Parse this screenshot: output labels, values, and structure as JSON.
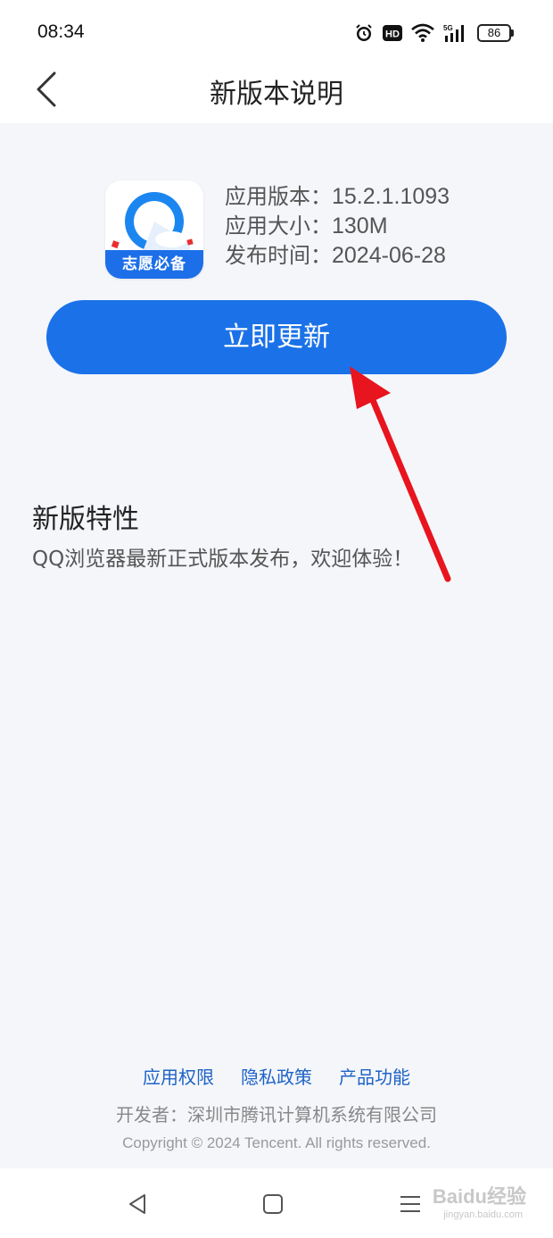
{
  "status_bar": {
    "time": "08:34",
    "icons": [
      "alarm-icon",
      "hd-icon",
      "wifi-icon",
      "5g-signal-icon"
    ],
    "hd_label": "HD",
    "network_label": "5G",
    "battery": "86"
  },
  "header": {
    "title": "新版本说明"
  },
  "app": {
    "icon_banner": "志愿必备",
    "version_label": "应用版本：",
    "version": "15.2.1.1093",
    "size_label": "应用大小：",
    "size": "130M",
    "date_label": "发布时间：",
    "date": "2024-06-28"
  },
  "update_button": {
    "label": "立即更新"
  },
  "features": {
    "heading": "新版特性",
    "text": "QQ浏览器最新正式版本发布，欢迎体验！"
  },
  "footer": {
    "links": [
      "应用权限",
      "隐私政策",
      "产品功能"
    ],
    "developer": "开发者：深圳市腾讯计算机系统有限公司",
    "copyright": "Copyright © 2024 Tencent. All rights reserved."
  },
  "watermark": {
    "text": "Baidu经验",
    "sub": "jingyan.baidu.com"
  },
  "colors": {
    "accent": "#1b72e8",
    "link": "#1f63c6",
    "background": "#f4f6fa",
    "annotation": "#e8141e"
  }
}
